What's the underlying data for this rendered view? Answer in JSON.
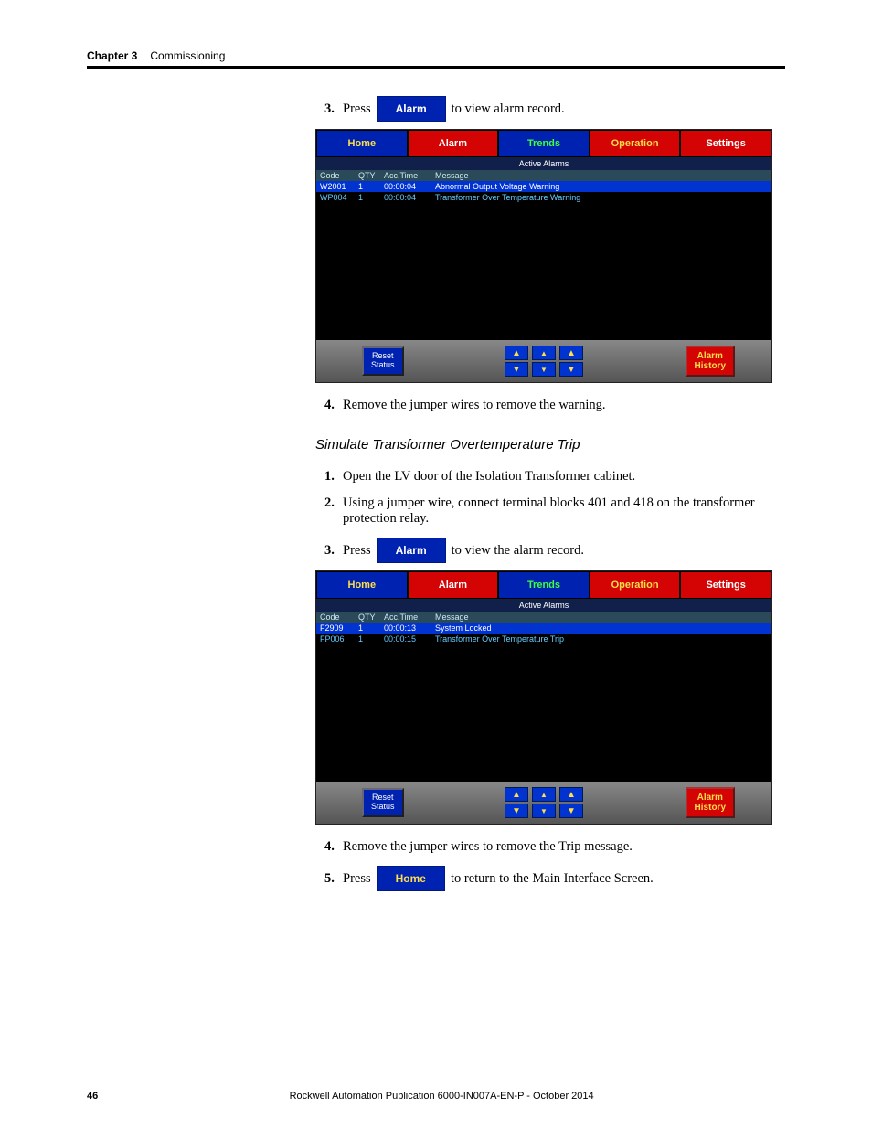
{
  "header": {
    "chapter": "Chapter 3",
    "title": "Commissioning"
  },
  "buttons": {
    "alarm": "Alarm",
    "home": "Home"
  },
  "steps_a": {
    "s3_pre": "Press",
    "s3_post": " to view alarm record.",
    "s4": "Remove the jumper wires to remove the warning."
  },
  "subsection": "Simulate Transformer Overtemperature Trip",
  "steps_b": {
    "s1": "Open the LV door of the Isolation Transformer cabinet.",
    "s2": "Using a jumper wire, connect terminal blocks 401 and 418 on the transformer protection relay.",
    "s3_pre": "Press",
    "s3_post": " to view the alarm record.",
    "s4": "Remove the jumper wires to remove the Trip message.",
    "s5_pre": "Press",
    "s5_post": " to return to the Main Interface Screen."
  },
  "hmi": {
    "tabs": {
      "home": "Home",
      "alarm": "Alarm",
      "trends": "Trends",
      "operation": "Operation",
      "settings": "Settings"
    },
    "active_title": "Active Alarms",
    "cols": {
      "code": "Code",
      "qty": "QTY",
      "acc": "Acc.Time",
      "msg": "Message"
    },
    "reset": "Reset\nStatus",
    "history": "Alarm\nHistory"
  },
  "hmi1_rows": [
    {
      "code": "W2001",
      "qty": "1",
      "acc": "00:00:04",
      "msg": "Abnormal Output Voltage Warning",
      "selected": true
    },
    {
      "code": "WP004",
      "qty": "1",
      "acc": "00:00:04",
      "msg": "Transformer Over Temperature Warning",
      "selected": false
    }
  ],
  "hmi2_rows": [
    {
      "code": "F2909",
      "qty": "1",
      "acc": "00:00:13",
      "msg": "System Locked",
      "selected": true
    },
    {
      "code": "FP006",
      "qty": "1",
      "acc": "00:00:15",
      "msg": "Transformer Over Temperature Trip",
      "selected": false
    }
  ],
  "footer": {
    "page": "46",
    "pub": "Rockwell Automation Publication 6000-IN007A-EN-P - October 2014"
  }
}
